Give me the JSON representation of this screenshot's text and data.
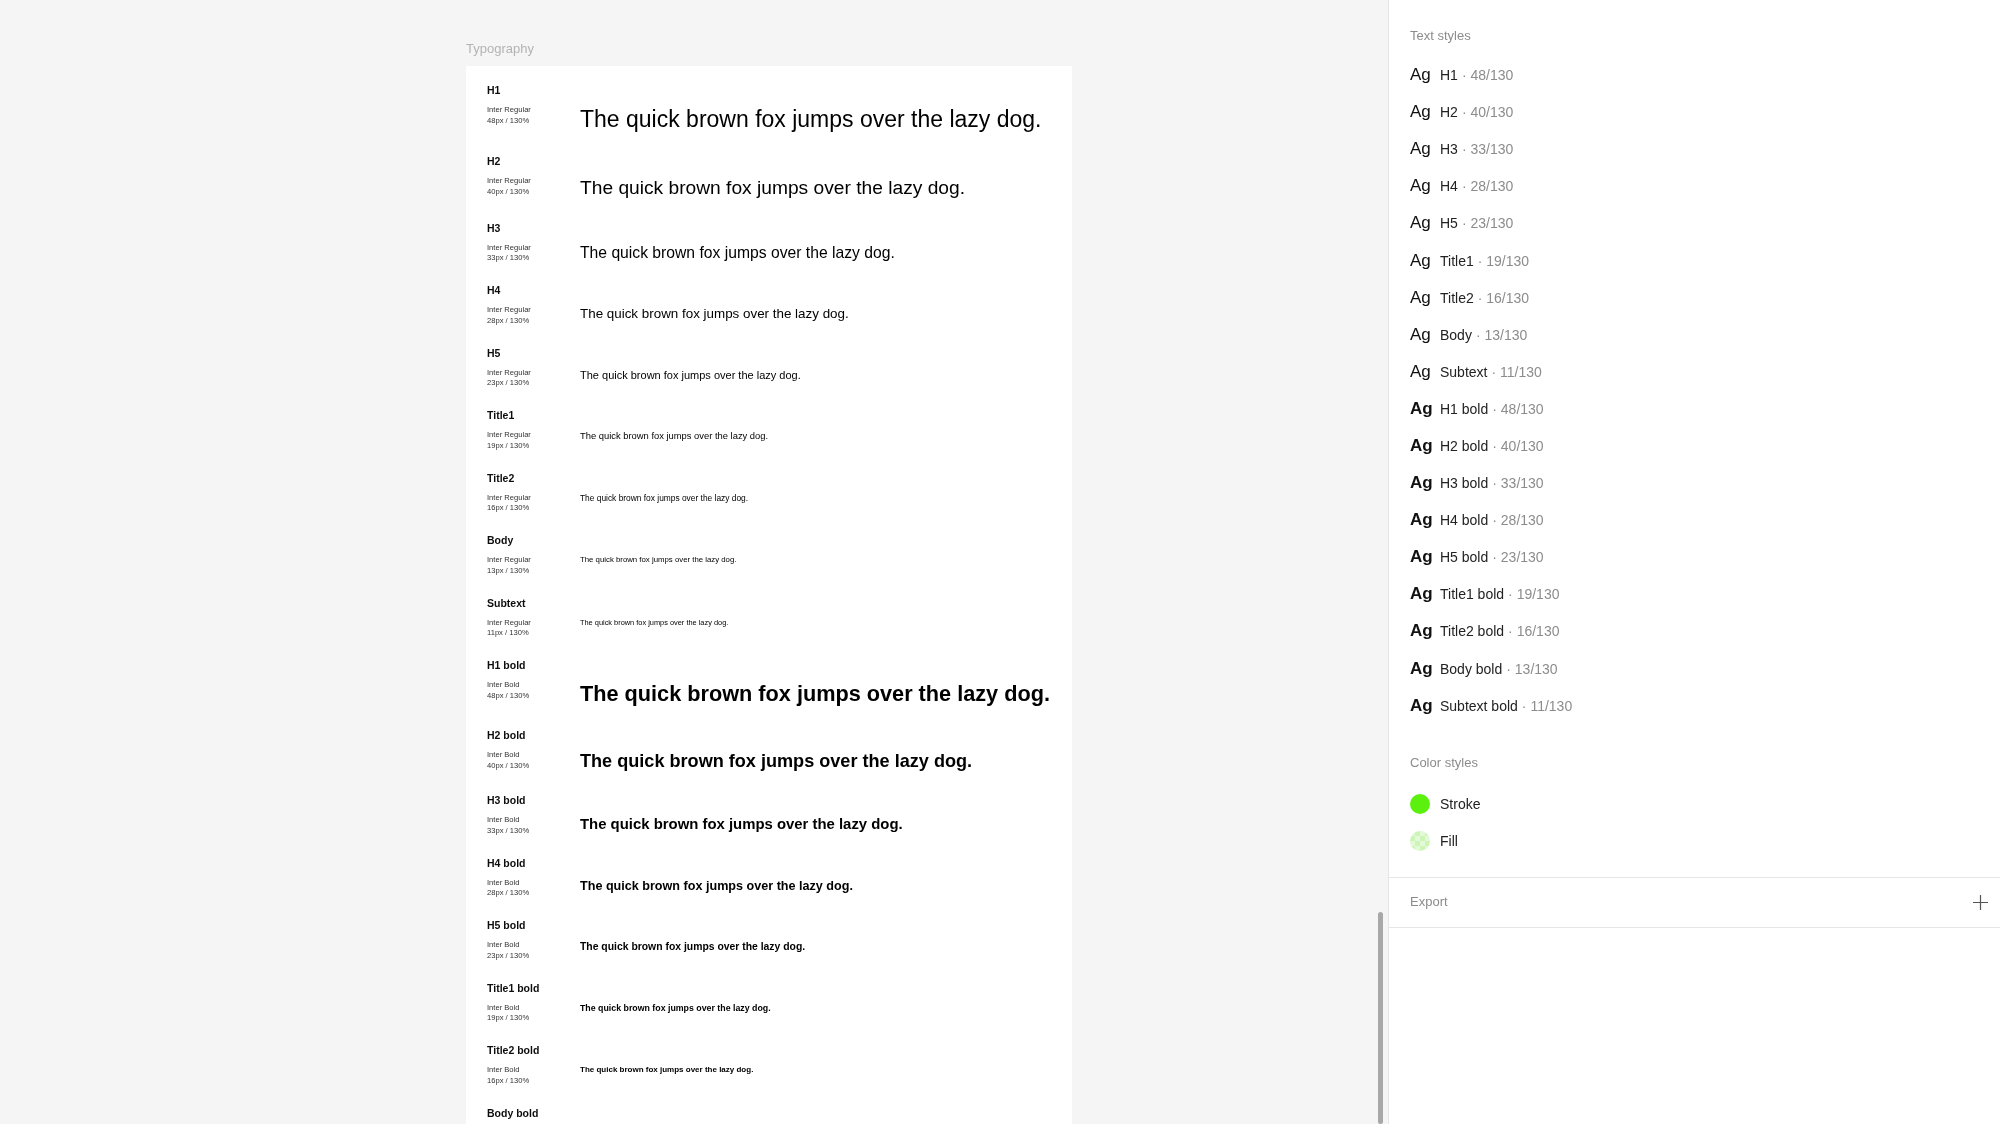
{
  "canvas": {
    "frame_label": "Typography",
    "rows": [
      {
        "name": "H1",
        "font": "Inter Regular",
        "spec": "48px / 130%",
        "sample": "The quick brown fox jumps over the lazy dog.",
        "kind": "regular"
      },
      {
        "name": "H2",
        "font": "Inter Regular",
        "spec": "40px / 130%",
        "sample": "The quick brown fox jumps over the lazy dog.",
        "kind": "regular"
      },
      {
        "name": "H3",
        "font": "Inter Regular",
        "spec": "33px / 130%",
        "sample": "The quick brown fox jumps over the lazy dog.",
        "kind": "regular"
      },
      {
        "name": "H4",
        "font": "Inter Regular",
        "spec": "28px / 130%",
        "sample": "The quick brown fox jumps over the lazy dog.",
        "kind": "regular"
      },
      {
        "name": "H5",
        "font": "Inter Regular",
        "spec": "23px / 130%",
        "sample": "The quick brown fox jumps over the lazy dog.",
        "kind": "regular"
      },
      {
        "name": "Title1",
        "font": "Inter Regular",
        "spec": "19px / 130%",
        "sample": "The quick brown fox jumps over the lazy dog.",
        "kind": "regular"
      },
      {
        "name": "Title2",
        "font": "Inter Regular",
        "spec": "16px / 130%",
        "sample": "The quick brown fox jumps over the lazy dog.",
        "kind": "regular"
      },
      {
        "name": "Body",
        "font": "Inter Regular",
        "spec": "13px / 130%",
        "sample": "The quick brown fox jumps over the lazy dog.",
        "kind": "regular"
      },
      {
        "name": "Subtext",
        "font": "Inter Regular",
        "spec": "11px / 130%",
        "sample": "The quick brown fox jumps over the lazy dog.",
        "kind": "regular"
      },
      {
        "name": "H1 bold",
        "font": "Inter Bold",
        "spec": "48px / 130%",
        "sample": "The quick brown fox jumps over the lazy dog.",
        "kind": "bold"
      },
      {
        "name": "H2 bold",
        "font": "Inter Bold",
        "spec": "40px / 130%",
        "sample": "The quick brown fox jumps over the lazy dog.",
        "kind": "bold"
      },
      {
        "name": "H3 bold",
        "font": "Inter Bold",
        "spec": "33px / 130%",
        "sample": "The quick brown fox jumps over the lazy dog.",
        "kind": "bold"
      },
      {
        "name": "H4 bold",
        "font": "Inter Bold",
        "spec": "28px / 130%",
        "sample": "The quick brown fox jumps over the lazy dog.",
        "kind": "bold"
      },
      {
        "name": "H5 bold",
        "font": "Inter Bold",
        "spec": "23px / 130%",
        "sample": "The quick brown fox jumps over the lazy dog.",
        "kind": "bold"
      },
      {
        "name": "Title1 bold",
        "font": "Inter Bold",
        "spec": "19px / 130%",
        "sample": "The quick brown fox jumps over the lazy dog.",
        "kind": "bold"
      },
      {
        "name": "Title2 bold",
        "font": "Inter Bold",
        "spec": "16px / 130%",
        "sample": "The quick brown fox jumps over the lazy dog.",
        "kind": "bold"
      },
      {
        "name": "Body bold",
        "kind": "bold"
      }
    ]
  },
  "panel": {
    "text_styles": {
      "title": "Text styles",
      "items": [
        {
          "preview": "Ag",
          "name": "H1",
          "detail": "· 48/130",
          "kind": "regular"
        },
        {
          "preview": "Ag",
          "name": "H2",
          "detail": "· 40/130",
          "kind": "regular"
        },
        {
          "preview": "Ag",
          "name": "H3",
          "detail": "· 33/130",
          "kind": "regular"
        },
        {
          "preview": "Ag",
          "name": "H4",
          "detail": "· 28/130",
          "kind": "regular"
        },
        {
          "preview": "Ag",
          "name": "H5",
          "detail": "· 23/130",
          "kind": "regular"
        },
        {
          "preview": "Ag",
          "name": "Title1",
          "detail": "· 19/130",
          "kind": "regular"
        },
        {
          "preview": "Ag",
          "name": "Title2",
          "detail": "· 16/130",
          "kind": "regular"
        },
        {
          "preview": "Ag",
          "name": "Body",
          "detail": "· 13/130",
          "kind": "regular"
        },
        {
          "preview": "Ag",
          "name": "Subtext",
          "detail": "· 11/130",
          "kind": "regular"
        },
        {
          "preview": "Ag",
          "name": "H1 bold",
          "detail": "· 48/130",
          "kind": "bold"
        },
        {
          "preview": "Ag",
          "name": "H2 bold",
          "detail": "· 40/130",
          "kind": "bold"
        },
        {
          "preview": "Ag",
          "name": "H3 bold",
          "detail": "· 33/130",
          "kind": "bold"
        },
        {
          "preview": "Ag",
          "name": "H4 bold",
          "detail": "· 28/130",
          "kind": "bold"
        },
        {
          "preview": "Ag",
          "name": "H5 bold",
          "detail": "· 23/130",
          "kind": "bold"
        },
        {
          "preview": "Ag",
          "name": "Title1 bold",
          "detail": "· 19/130",
          "kind": "bold"
        },
        {
          "preview": "Ag",
          "name": "Title2 bold",
          "detail": "· 16/130",
          "kind": "bold"
        },
        {
          "preview": "Ag",
          "name": "Body bold",
          "detail": "· 13/130",
          "kind": "bold"
        },
        {
          "preview": "Ag",
          "name": "Subtext bold",
          "detail": "· 11/130",
          "kind": "bold"
        }
      ]
    },
    "color_styles": {
      "title": "Color styles",
      "items": [
        {
          "name": "Stroke",
          "color": "#5cf00f",
          "kind": "solid"
        },
        {
          "name": "Fill",
          "color": "#cdf5b8",
          "kind": "translucent"
        }
      ]
    },
    "export": {
      "title": "Export"
    }
  }
}
